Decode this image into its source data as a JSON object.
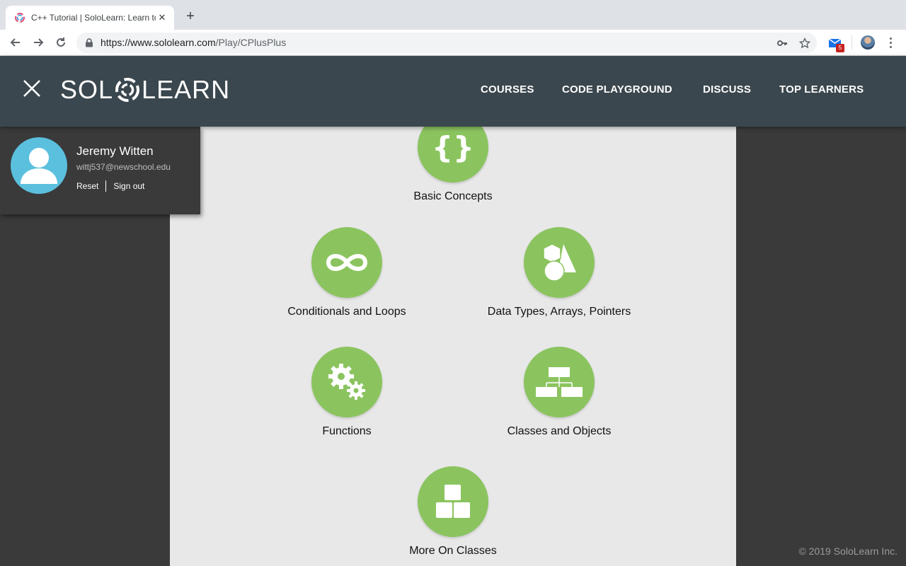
{
  "browser": {
    "tab_title": "C++ Tutorial | SoloLearn: Learn to code",
    "tab_close": "✕",
    "new_tab": "+",
    "url_host": "https://www.sololearn.com",
    "url_path": "/Play/CPlusPlus",
    "mail_badge": "5"
  },
  "header": {
    "logo_left": "SOL",
    "logo_right": "LEARN",
    "nav": [
      "COURSES",
      "CODE PLAYGROUND",
      "DISCUSS",
      "TOP LEARNERS"
    ]
  },
  "user": {
    "name": "Jeremy Witten",
    "email": "wittj537@newschool.edu",
    "reset": "Reset",
    "sign_out": "Sign out"
  },
  "modules": [
    {
      "label": "Basic Concepts",
      "icon": "braces-icon"
    },
    {
      "label": "Conditionals and Loops",
      "icon": "infinity-icon"
    },
    {
      "label": "Data Types, Arrays, Pointers",
      "icon": "shapes-icon"
    },
    {
      "label": "Functions",
      "icon": "gears-icon"
    },
    {
      "label": "Classes and Objects",
      "icon": "hierarchy-icon"
    },
    {
      "label": "More On Classes",
      "icon": "blocks-icon"
    }
  ],
  "footer": {
    "copyright": "© 2019 SoloLearn Inc."
  },
  "colors": {
    "accent": "#8bc45f",
    "header_bg": "#3b474e",
    "avatar_bg": "#5bc0de"
  }
}
